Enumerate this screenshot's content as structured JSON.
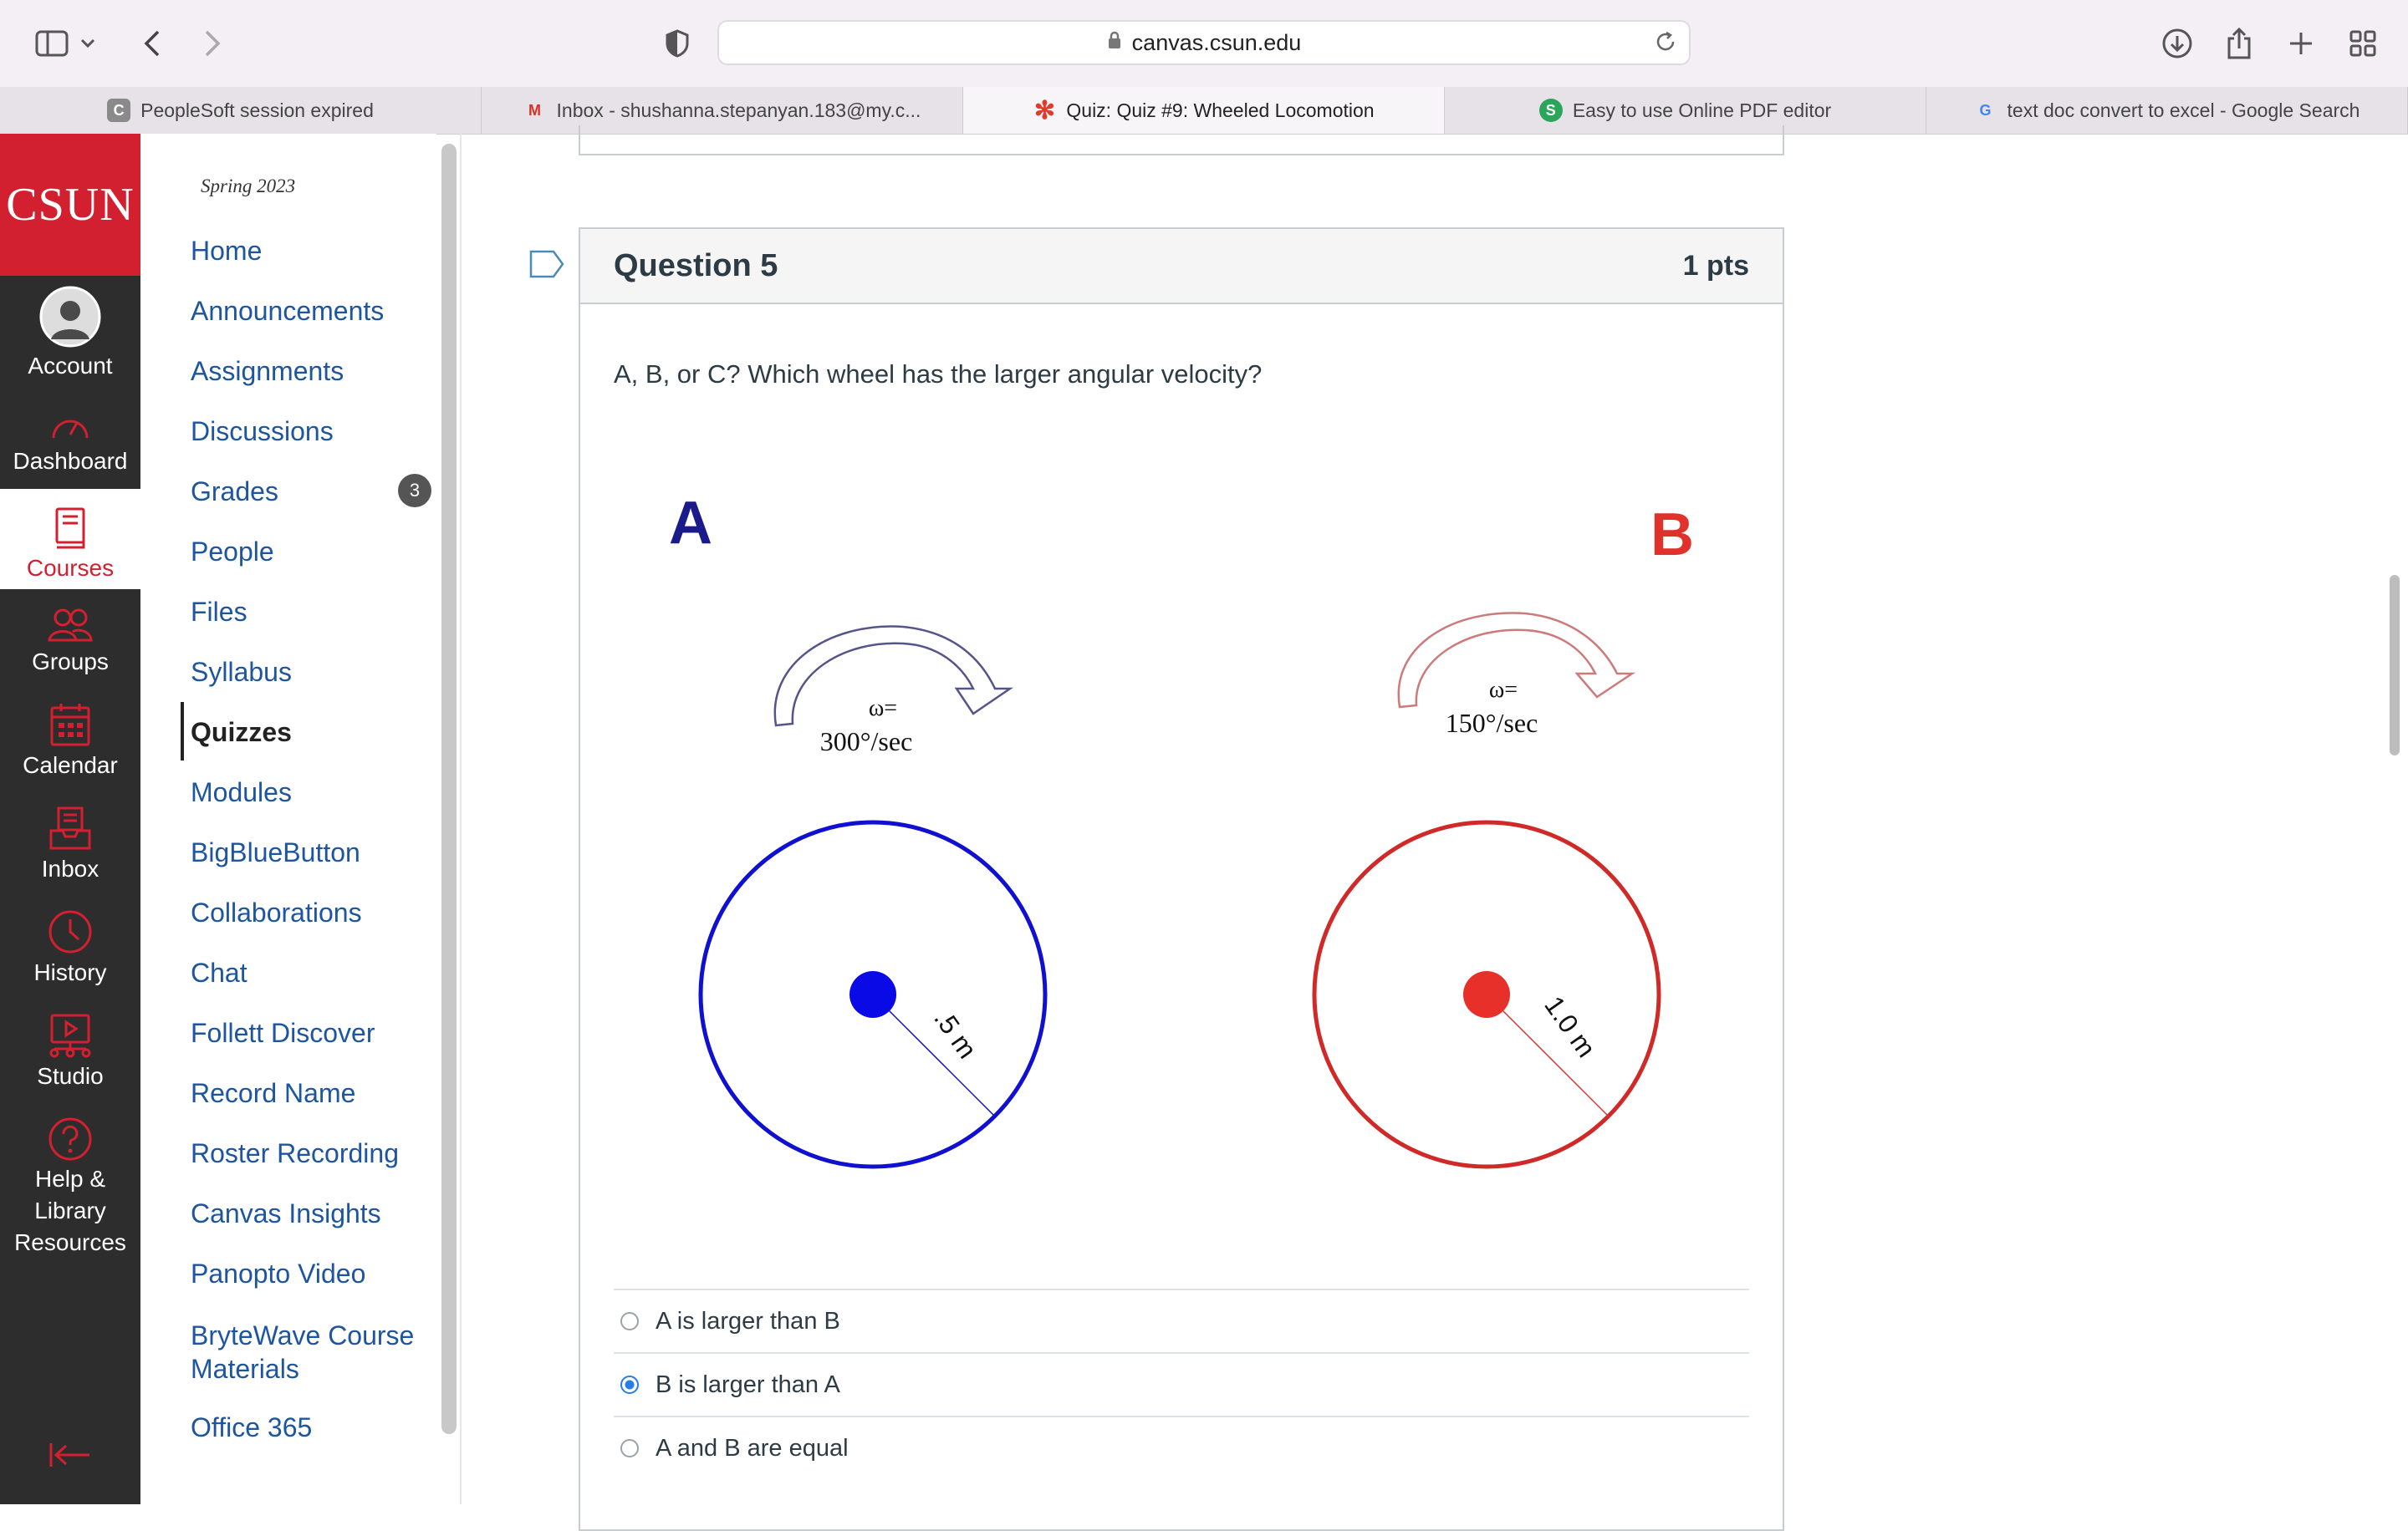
{
  "browser": {
    "url": "canvas.csun.edu",
    "tabs": [
      {
        "label": "PeopleSoft session expired",
        "fav": "C",
        "fav_color": "#8a8a8a"
      },
      {
        "label": "Inbox - shushanna.stepanyan.183@my.c...",
        "fav": "M",
        "fav_color": "#d93025"
      },
      {
        "label": "Quiz: Quiz #9: Wheeled Locomotion",
        "fav": "✻",
        "fav_color": "#e23b2e"
      },
      {
        "label": "Easy to use Online PDF editor",
        "fav": "S",
        "fav_color": "#2aa55a"
      },
      {
        "label": "text doc convert to excel - Google Search",
        "fav": "G",
        "fav_color": "#4285f4"
      }
    ]
  },
  "global_nav": {
    "logo": "CSUN",
    "items": [
      "Account",
      "Dashboard",
      "Courses",
      "Groups",
      "Calendar",
      "Inbox",
      "History",
      "Studio",
      "Help & Library Resources"
    ],
    "brand_color": "#d22030"
  },
  "course_nav": {
    "term": "Spring 2023",
    "items": [
      "Home",
      "Announcements",
      "Assignments",
      "Discussions",
      "Grades",
      "People",
      "Files",
      "Syllabus",
      "Quizzes",
      "Modules",
      "BigBlueButton",
      "Collaborations",
      "Chat",
      "Follett Discover",
      "Record Name",
      "Roster Recording",
      "Canvas Insights",
      "Panopto Video",
      "BryteWave Course Materials",
      "Office 365"
    ],
    "active": "Quizzes",
    "grades_badge": "3"
  },
  "question": {
    "title": "Question 5",
    "points": "1 pts",
    "text": "A, B, or C? Which wheel has the larger angular velocity?",
    "wheel_a": {
      "label": "A",
      "omega_label": "ω=",
      "omega_value": "300°/sec",
      "radius_label": ".5 m",
      "color": "#1010d0"
    },
    "wheel_b": {
      "label": "B",
      "omega_label": "ω=",
      "omega_value": "150°/sec",
      "radius_label": "1.0 m",
      "color": "#e0322b"
    },
    "answers": [
      {
        "label": "A is larger than B",
        "checked": false
      },
      {
        "label": "B is larger than A",
        "checked": true
      },
      {
        "label": "A and B are equal",
        "checked": false
      }
    ]
  }
}
